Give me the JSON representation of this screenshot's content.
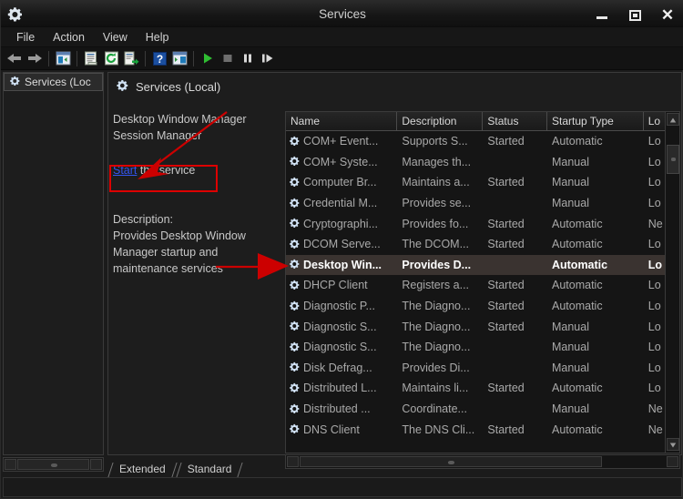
{
  "window": {
    "title": "Services",
    "icon": "services-gear-icon",
    "minimize_label": "Minimize",
    "maximize_label": "Maximize",
    "close_label": "Close"
  },
  "menubar": {
    "items": [
      {
        "label": "File"
      },
      {
        "label": "Action"
      },
      {
        "label": "View"
      },
      {
        "label": "Help"
      }
    ]
  },
  "toolbar": {
    "items": [
      {
        "name": "back-icon",
        "label": "Back"
      },
      {
        "name": "forward-icon",
        "label": "Forward"
      },
      {
        "name": "show-hide-console-tree-icon",
        "label": "Show/Hide Console Tree"
      },
      {
        "name": "properties-icon",
        "label": "Properties"
      },
      {
        "name": "refresh-icon",
        "label": "Refresh"
      },
      {
        "name": "export-list-icon",
        "label": "Export List"
      },
      {
        "name": "help-icon",
        "label": "Help"
      },
      {
        "name": "show-action-pane-icon",
        "label": "Show/Hide Action Pane"
      },
      {
        "name": "start-service-icon",
        "label": "Start Service"
      },
      {
        "name": "stop-service-icon",
        "label": "Stop Service"
      },
      {
        "name": "pause-service-icon",
        "label": "Pause Service"
      },
      {
        "name": "restart-service-icon",
        "label": "Restart Service"
      }
    ]
  },
  "tree": {
    "root_label": "Services (Loc"
  },
  "pane": {
    "header": "Services (Local)",
    "service_name_line1": "Desktop Window Manager",
    "service_name_line2": "Session Manager",
    "action_link": "Start",
    "action_rest": " the service",
    "description_label": "Description:",
    "description_line1": "Provides Desktop Window",
    "description_line2": "Manager startup and",
    "description_line3": "maintenance services"
  },
  "list": {
    "columns": [
      {
        "label": "Name",
        "key": "name"
      },
      {
        "label": "Description",
        "key": "description"
      },
      {
        "label": "Status",
        "key": "status"
      },
      {
        "label": "Startup Type",
        "key": "startup"
      },
      {
        "label": "Lo",
        "key": "logon"
      }
    ],
    "rows": [
      {
        "name": "COM+ Event...",
        "description": "Supports S...",
        "status": "Started",
        "startup": "Automatic",
        "logon": "Lo",
        "selected": false
      },
      {
        "name": "COM+ Syste...",
        "description": "Manages th...",
        "status": "",
        "startup": "Manual",
        "logon": "Lo",
        "selected": false
      },
      {
        "name": "Computer Br...",
        "description": "Maintains a...",
        "status": "Started",
        "startup": "Manual",
        "logon": "Lo",
        "selected": false
      },
      {
        "name": "Credential M...",
        "description": "Provides se...",
        "status": "",
        "startup": "Manual",
        "logon": "Lo",
        "selected": false
      },
      {
        "name": "Cryptographi...",
        "description": "Provides fo...",
        "status": "Started",
        "startup": "Automatic",
        "logon": "Ne",
        "selected": false
      },
      {
        "name": "DCOM Serve...",
        "description": "The DCOM...",
        "status": "Started",
        "startup": "Automatic",
        "logon": "Lo",
        "selected": false
      },
      {
        "name": "Desktop Win...",
        "description": "Provides D...",
        "status": "",
        "startup": "Automatic",
        "logon": "Lo",
        "selected": true
      },
      {
        "name": "DHCP Client",
        "description": "Registers a...",
        "status": "Started",
        "startup": "Automatic",
        "logon": "Lo",
        "selected": false
      },
      {
        "name": "Diagnostic P...",
        "description": "The Diagno...",
        "status": "Started",
        "startup": "Automatic",
        "logon": "Lo",
        "selected": false
      },
      {
        "name": "Diagnostic S...",
        "description": "The Diagno...",
        "status": "Started",
        "startup": "Manual",
        "logon": "Lo",
        "selected": false
      },
      {
        "name": "Diagnostic S...",
        "description": "The Diagno...",
        "status": "",
        "startup": "Manual",
        "logon": "Lo",
        "selected": false
      },
      {
        "name": "Disk Defrag...",
        "description": "Provides Di...",
        "status": "",
        "startup": "Manual",
        "logon": "Lo",
        "selected": false
      },
      {
        "name": "Distributed L...",
        "description": "Maintains li...",
        "status": "Started",
        "startup": "Automatic",
        "logon": "Lo",
        "selected": false
      },
      {
        "name": "Distributed ...",
        "description": "Coordinate...",
        "status": "",
        "startup": "Manual",
        "logon": "Ne",
        "selected": false
      },
      {
        "name": "DNS Client",
        "description": "The DNS Cli...",
        "status": "Started",
        "startup": "Automatic",
        "logon": "Ne",
        "selected": false
      }
    ]
  },
  "tabs": [
    {
      "label": "Extended",
      "active": false
    },
    {
      "label": "Standard",
      "active": true
    }
  ],
  "annotations": {
    "highlight_color": "#dd0000",
    "arrow_to_start_link": "arrow pointing to Start the service link",
    "arrow_to_selected_row": "arrow pointing to Desktop Window Manager row"
  }
}
